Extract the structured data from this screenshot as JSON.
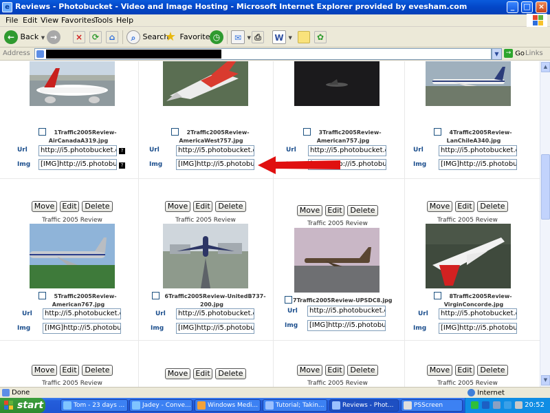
{
  "window": {
    "title": "Reviews - Photobucket - Video and Image Hosting - Microsoft Internet Explorer provided by evesham.com",
    "min": "_",
    "max": "□",
    "close": "×"
  },
  "menu": [
    "File",
    "Edit",
    "View",
    "Favorites",
    "Tools",
    "Help"
  ],
  "toolbar": {
    "back": "Back",
    "search": "Search",
    "favorites": "Favorites"
  },
  "address": {
    "label": "Address",
    "go": "Go",
    "links": "Links"
  },
  "content": {
    "url_label": "Url",
    "img_label": "Img",
    "url_value": "http://i5.photobucket.com",
    "img_value": "[IMG]http://i5.photobucket",
    "buttons": {
      "move": "Move",
      "edit": "Edit",
      "delete": "Delete"
    },
    "caption": "Traffic 2005 Review",
    "row1": [
      {
        "line1": "1Traffic2005Review-",
        "line2": "AirCanadaA319.jpg"
      },
      {
        "line1": "2Traffic2005Review-",
        "line2": "AmericaWest757.jpg"
      },
      {
        "line1": "3Traffic2005Review-",
        "line2": "American757.jpg"
      },
      {
        "line1": "4Traffic2005Review-",
        "line2": "LanChileA340.jpg"
      }
    ],
    "row2": [
      {
        "line1": "5Traffic2005Review-",
        "line2": "American767.jpg"
      },
      {
        "line1": "6Traffic2005Review-UnitedB737-",
        "line2": "200.jpg"
      },
      {
        "line1": "7Traffic2005Review-UPSDC8.jpg",
        "line2": ""
      },
      {
        "line1": "8Traffic2005Review-",
        "line2": "VirginConcorde.jpg"
      }
    ]
  },
  "status": {
    "text": "Done",
    "zone": "Internet"
  },
  "taskbar": {
    "start": "start",
    "tasks": [
      "Tom - 23 days ...",
      "Jadey - Conve...",
      "Windows Medi...",
      "Tutorial; Takin...",
      "Reviews - Phot...",
      "PSScreen"
    ],
    "clock": "20:52"
  }
}
